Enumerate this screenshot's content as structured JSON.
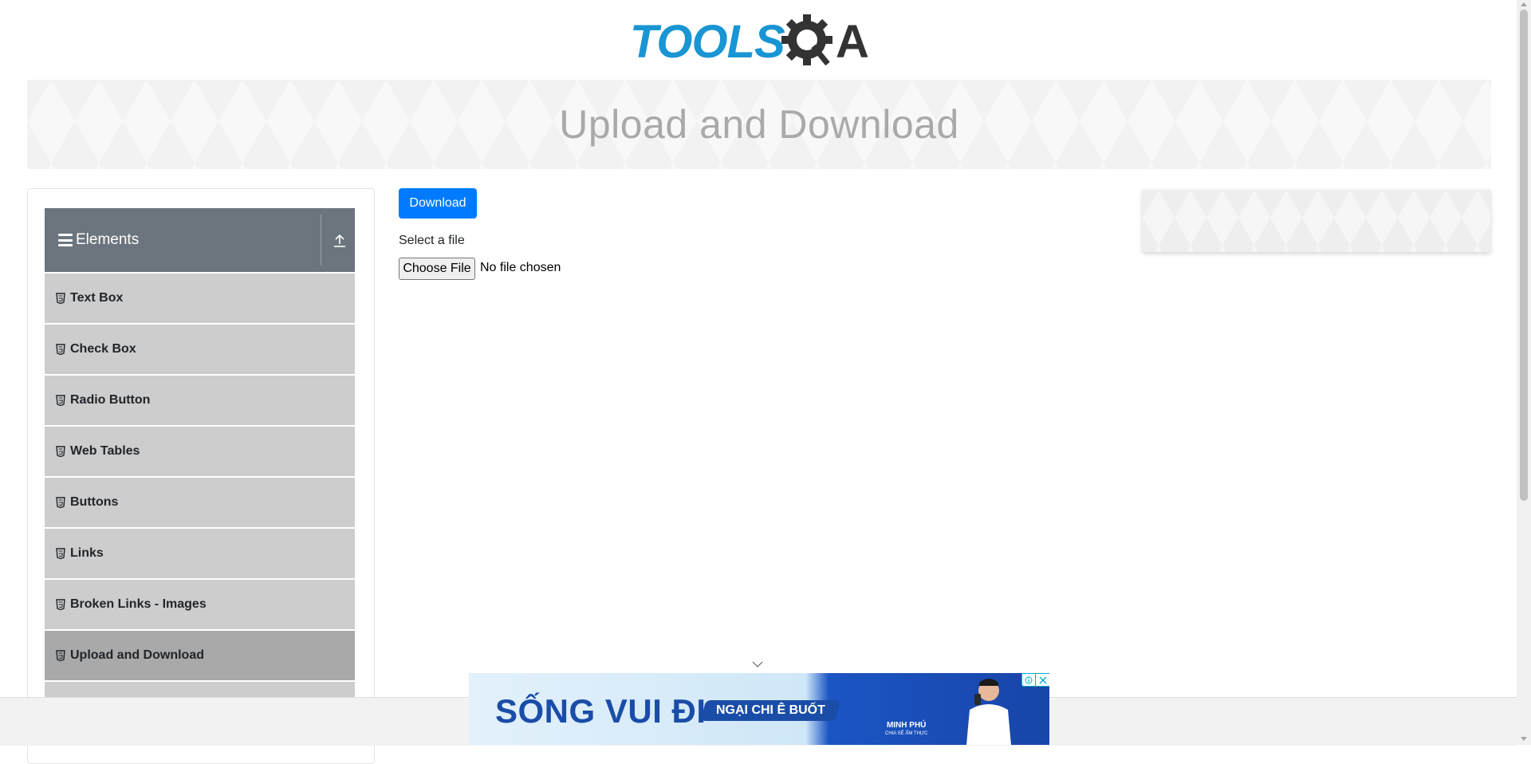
{
  "header": {
    "logo_text": "TOOLSQA",
    "logo_colors": {
      "tools": "#1a95d3",
      "qa": "#333333"
    }
  },
  "banner": {
    "title": "Upload and Download"
  },
  "sidebar": {
    "group_title": "Elements",
    "group_icon": "hamburger-icon",
    "collapse_icon": "upload-arrow-icon",
    "item_icon": "html5-shield-icon",
    "items": [
      {
        "label": "Text Box"
      },
      {
        "label": "Check Box"
      },
      {
        "label": "Radio Button"
      },
      {
        "label": "Web Tables"
      },
      {
        "label": "Buttons"
      },
      {
        "label": "Links"
      },
      {
        "label": "Broken Links - Images"
      },
      {
        "label": "Upload and Download",
        "active": true
      }
    ]
  },
  "main": {
    "download_button": "Download",
    "select_label": "Select a file",
    "choose_file_button": "Choose File",
    "file_status": "No file chosen"
  },
  "ad": {
    "headline": "SỐNG VUI ĐI",
    "pill": "NGẠI CHI Ê BUỐT",
    "brand": "MINH PHÚ",
    "brand_sub": "CHIA SẺ ẨM THỰC",
    "info_icon": "adchoices-info-icon",
    "close_icon": "close-icon"
  },
  "colors": {
    "primary": "#007bff",
    "sidebar_header": "#6c757d",
    "sidebar_item": "#cdcdcd",
    "sidebar_item_active": "#a9a9a9"
  }
}
